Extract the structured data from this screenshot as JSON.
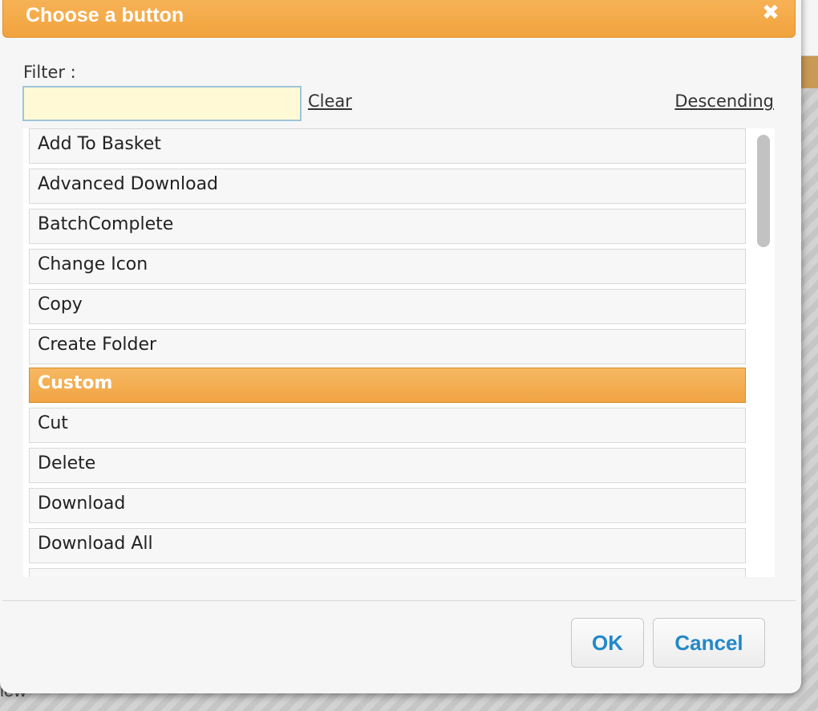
{
  "background": {
    "partial_text": "iew"
  },
  "dialog": {
    "title": "Choose a button",
    "close_glyph": "✖",
    "filter": {
      "label": "Filter :",
      "value": "",
      "placeholder": ""
    },
    "clear_label": "Clear",
    "sort_label": "Descending",
    "items": [
      "Add To Basket",
      "Advanced Download",
      "BatchComplete",
      "Change Icon",
      "Copy",
      "Create Folder",
      "Custom",
      "Cut",
      "Delete",
      "Download",
      "Download All"
    ],
    "selected_item": "Custom",
    "ok_label": "OK",
    "cancel_label": "Cancel"
  },
  "colors": {
    "accent": "#f2a33d",
    "button_text": "#2388c8",
    "filter_bg": "#fff9d6"
  }
}
